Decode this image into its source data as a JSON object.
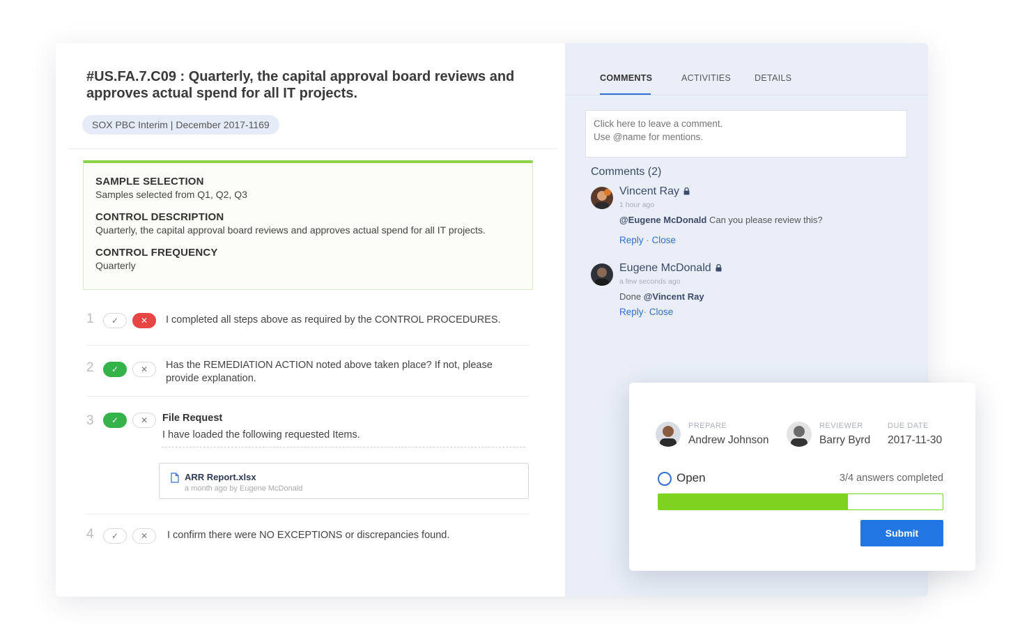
{
  "control": {
    "title": "#US.FA.7.C09 : Quarterly, the capital approval board reviews and approves actual spend for all IT projects.",
    "tag": "SOX PBC Interim | December 2017-1169"
  },
  "info": [
    {
      "heading": "SAMPLE SELECTION",
      "text": "Samples selected from Q1, Q2, Q3"
    },
    {
      "heading": "CONTROL DESCRIPTION",
      "text": "Quarterly, the capital approval board reviews and approves actual spend for all IT projects."
    },
    {
      "heading": "CONTROL FREQUENCY",
      "text": "Quarterly"
    }
  ],
  "questions": [
    {
      "number": "1",
      "text": "I completed all steps above as required by the CONTROL PROCEDURES.",
      "answer": "no"
    },
    {
      "number": "2",
      "text": "Has the REMEDIATION ACTION noted above taken place? If not, please provide explanation.",
      "answer": "yes"
    },
    {
      "number": "3",
      "title": "File Request",
      "text": "I have loaded the following requested Items.",
      "answer": "yes"
    },
    {
      "number": "4",
      "text": "I confirm there were NO EXCEPTIONS or discrepancies found.",
      "answer": "none"
    }
  ],
  "file": {
    "name": "ARR Report.xlsx",
    "meta": "a month ago by Eugene McDonald"
  },
  "icons": {
    "check": "✓",
    "cross": "✕"
  },
  "tabs": {
    "comments": "COMMENTS",
    "activities": "ACTIVITIES",
    "details": "DETAILS"
  },
  "comment_input": {
    "placeholder": "Click here to leave a comment.\nUse @name for mentions."
  },
  "comments_title": "Comments (2)",
  "comments": [
    {
      "author": "Vincent Ray",
      "time": "1 hour ago",
      "mention": "@Eugene McDonald",
      "text": " Can you please review this?",
      "reply": "Reply",
      "sep": " · ",
      "close": "Close"
    },
    {
      "author": "Eugene McDonald",
      "time": "a few seconds ago",
      "prefix": "Done ",
      "mention": "@Vincent Ray",
      "reply": "Reply",
      "sep": "· ",
      "close": "Close"
    }
  ],
  "panel": {
    "prepare": {
      "role": "PREPARE",
      "name": "Andrew Johnson"
    },
    "reviewer": {
      "role": "REVIEWER",
      "name": "Barry Byrd"
    },
    "due": {
      "role": "DUE DATE",
      "value": "2017-11-30"
    },
    "status": "Open",
    "answers": "3/4 answers completed",
    "progress_fraction": 0.667,
    "submit": "Submit"
  },
  "colors": {
    "accent": "#2f6fd6",
    "green": "#34b34a",
    "red": "#e84545",
    "progress": "#7ed321"
  }
}
